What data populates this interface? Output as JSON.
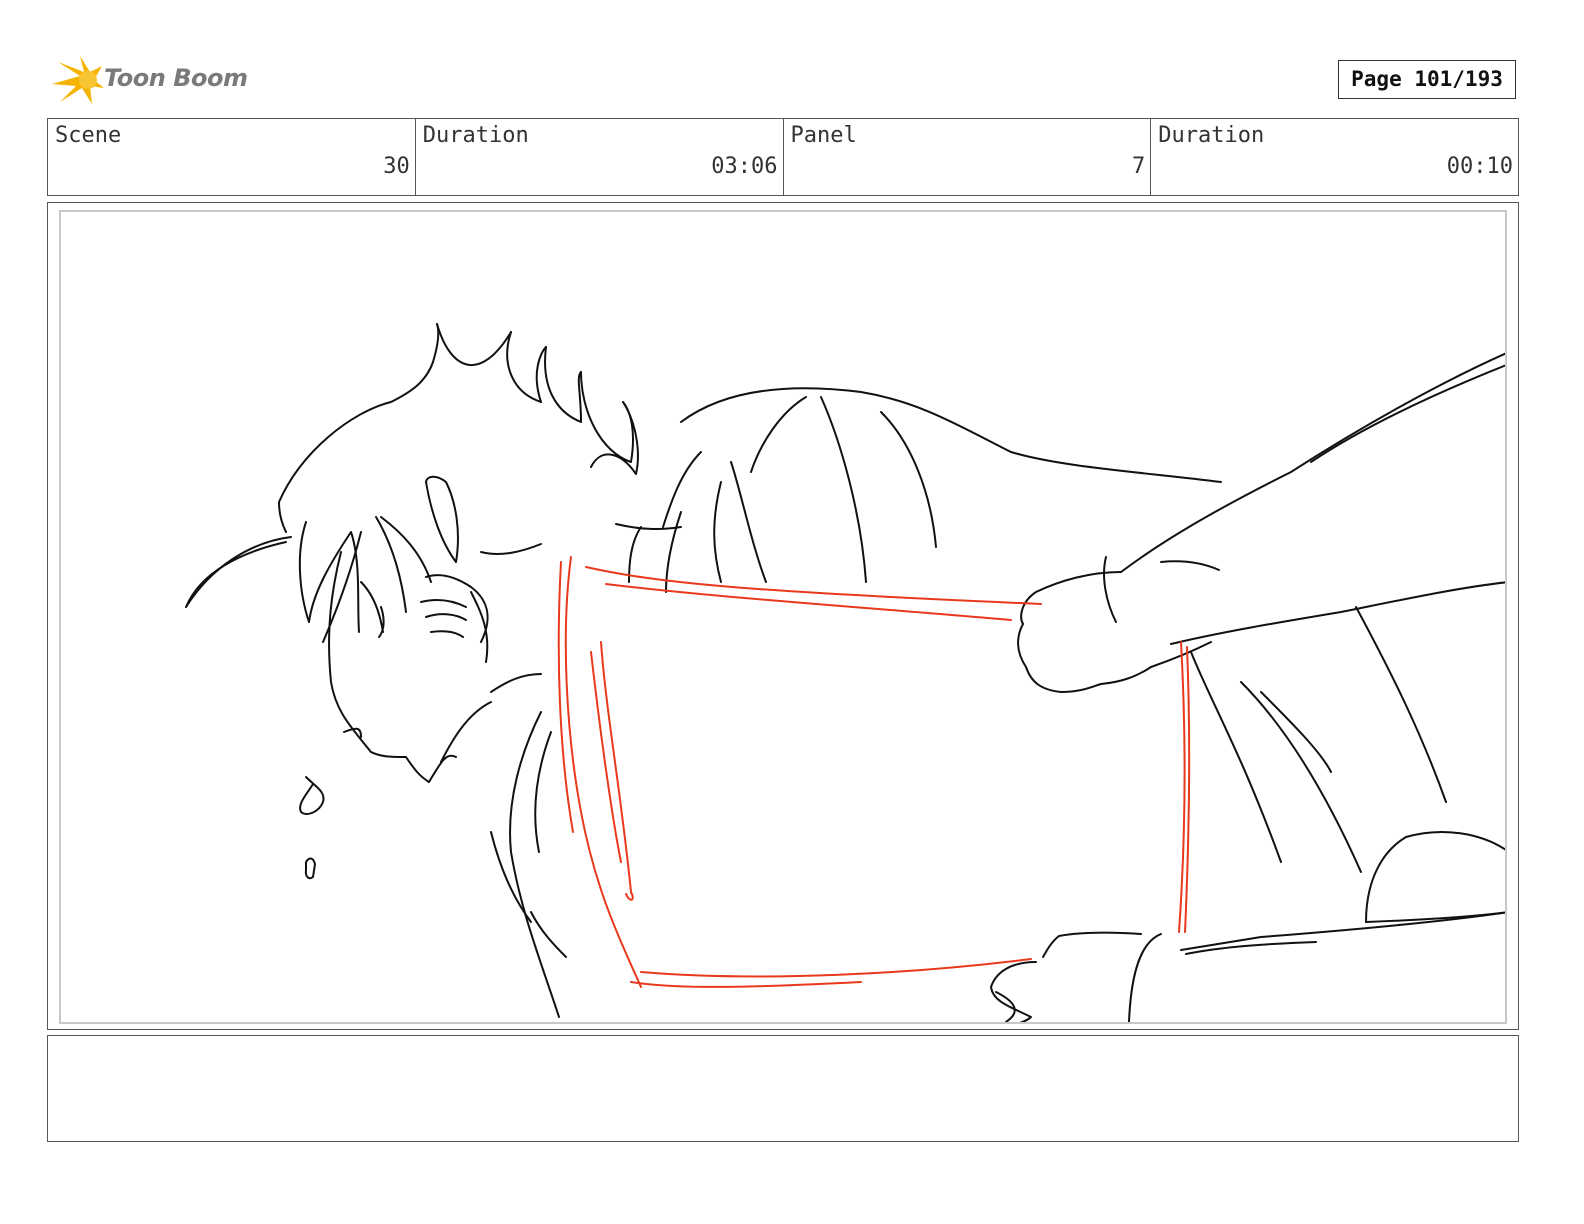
{
  "header": {
    "logo_text": "Toon Boom",
    "page_label": "Page 101/193"
  },
  "info": {
    "scene_label": "Scene",
    "scene_value": "30",
    "scene_duration_label": "Duration",
    "scene_duration_value": "03:06",
    "panel_label": "Panel",
    "panel_value": "7",
    "panel_duration_label": "Duration",
    "panel_duration_value": "00:10"
  },
  "colors": {
    "sketch_line": "#111111",
    "sketch_accent": "#e8391c",
    "logo_flame": "#f5b400"
  },
  "notes": {
    "text": ""
  }
}
